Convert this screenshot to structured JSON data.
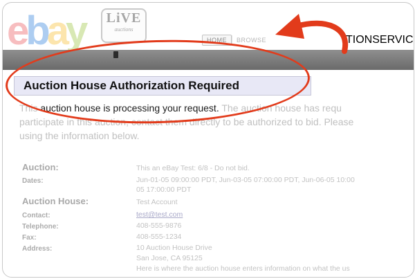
{
  "logo": {
    "letters": [
      "e",
      "b",
      "a",
      "y"
    ]
  },
  "badge": {
    "big": "LiVE",
    "small": "auctions"
  },
  "nav": {
    "tabs": [
      "HOME",
      "BROWSE"
    ],
    "right_tabs": [
      "TION",
      "SERVICES"
    ]
  },
  "title": "Auction House Authorization Required",
  "paragraph": {
    "line1_start": "This ",
    "line1_dark": "auction house is processing your request.",
    "line1_end": " The auction house  has requ",
    "line2": "participate in this auction, contact them directly to be authorized to bid. Please",
    "line3": "using the information below."
  },
  "details": {
    "auction_label": "Auction:",
    "auction_value": "This an eBay Test: 6/8 - Do not bid.",
    "dates_label": "Dates:",
    "dates_value_1": "Jun-01-05 09:00:00 PDT, Jun-03-05 07:00:00 PDT, Jun-06-05 10:00",
    "dates_value_2": "05 17:00:00 PDT",
    "house_label": "Auction House:",
    "house_value": "Test Account",
    "contact_label": "Contact:",
    "contact_value": "test@test.com",
    "telephone_label": "Telephone:",
    "telephone_value": "408-555-9876",
    "fax_label": "Fax:",
    "fax_value": "408-555-1234",
    "address_label": "Address:",
    "address_value_1": "10 Auction House Drive",
    "address_value_2": "San Jose, CA 95125",
    "address_value_3": "Here is where the auction house enters information on what the us"
  },
  "colors": {
    "annotation": "#e23b1b",
    "title_box": "#e8e8f6",
    "header_bar": "#7c7c7c"
  }
}
